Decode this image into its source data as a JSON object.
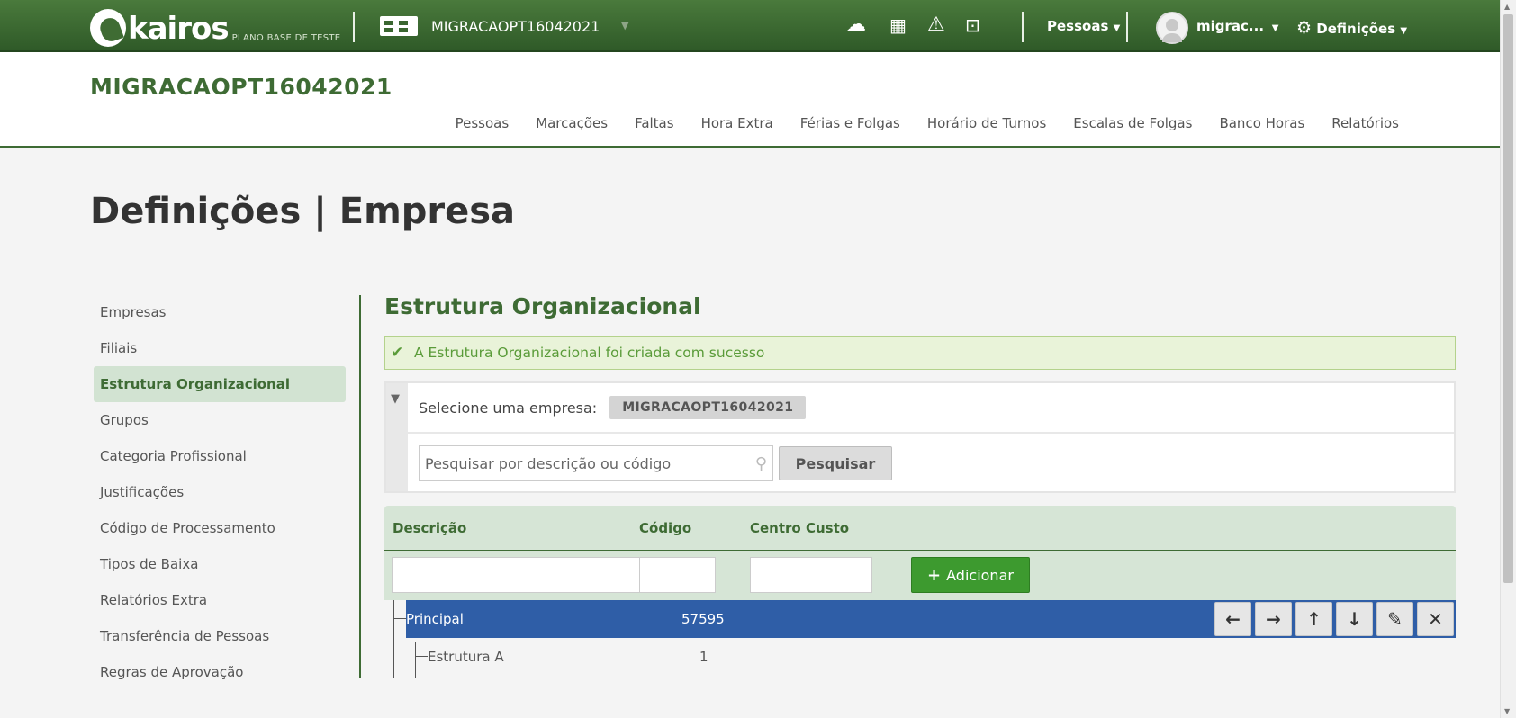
{
  "topbar": {
    "logo_text": "kairos",
    "logo_sub": "PLANO BASE DE TESTE",
    "company": "MIGRACAOPT16042021",
    "icons": [
      "cloud-upload-icon",
      "calculator-icon",
      "warning-icon",
      "inbox-icon"
    ],
    "pessoas_menu": "Pessoas",
    "user_name": "migrac...",
    "settings_menu": "Definições"
  },
  "header": {
    "company_title": "MIGRACAOPT16042021",
    "nav": [
      "Pessoas",
      "Marcações",
      "Faltas",
      "Hora Extra",
      "Férias e Folgas",
      "Horário de Turnos",
      "Escalas de Folgas",
      "Banco Horas",
      "Relatórios"
    ]
  },
  "page_title": "Definições | Empresa",
  "sidebar": {
    "items": [
      "Empresas",
      "Filiais",
      "Estrutura Organizacional",
      "Grupos",
      "Categoria Profissional",
      "Justificações",
      "Código de Processamento",
      "Tipos de Baixa",
      "Relatórios Extra",
      "Transferência de Pessoas",
      "Regras de Aprovação"
    ],
    "active_index": 2
  },
  "main": {
    "section_title": "Estrutura Organizacional",
    "alert": "A Estrutura Organizacional foi criada com sucesso",
    "filter": {
      "select_label": "Selecione uma empresa:",
      "company_chip": "MIGRACAOPT16042021",
      "search_placeholder": "Pesquisar por descrição ou código",
      "search_button": "Pesquisar"
    },
    "table": {
      "headers": [
        "Descrição",
        "Código",
        "Centro Custo"
      ],
      "add_button": "Adicionar",
      "rows": [
        {
          "descricao": "Principal",
          "codigo": "57595",
          "selected": true
        },
        {
          "descricao": "Estrutura A",
          "codigo": "1",
          "selected": false
        }
      ]
    }
  },
  "colors": {
    "brand_green": "#3e6b34",
    "selected_row": "#2f5ea7",
    "add_button": "#3d9a2f",
    "alert_bg": "#e9f3d9"
  }
}
